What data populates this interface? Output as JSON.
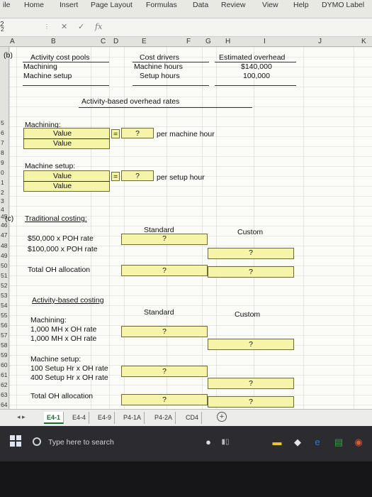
{
  "ribbon": {
    "tabs": [
      "ile",
      "Home",
      "Insert",
      "Page Layout",
      "Formulas",
      "Data",
      "Review",
      "View",
      "Help",
      "DYMO Label"
    ]
  },
  "formula_bar": {
    "name_box": "2",
    "cancel_symbol": "✕",
    "enter_symbol": "✓",
    "fx_label": "fx",
    "content": ""
  },
  "columns": [
    "A",
    "B",
    "C",
    "D",
    "E",
    "F",
    "G",
    "H",
    "I",
    "J",
    "K"
  ],
  "rows": [
    "2",
    "5",
    "6",
    "7",
    "8",
    "9",
    "0",
    "1",
    "2",
    "3",
    "4",
    "45",
    "46",
    "47",
    "48",
    "49",
    "50",
    "51",
    "52",
    "53",
    "54",
    "55",
    "56",
    "57",
    "58",
    "59",
    "60",
    "61",
    "62",
    "63",
    "64"
  ],
  "part_b": {
    "label": "(b)",
    "col1_header": "Activity cost pools",
    "col1_rows": [
      "Machining",
      "Machine setup"
    ],
    "col2_header": "Cost drivers",
    "col2_rows": [
      "Machine hours",
      "Setup hours"
    ],
    "col3_header": "Estimated overhead",
    "col3_rows": [
      "$140,000",
      "100,000"
    ],
    "rates_title": "Activity-based overhead rates",
    "machining_label": "Machining:",
    "machining_value1": "Value",
    "machining_value2": "Value",
    "equals": "=",
    "machining_answer": "?",
    "machining_unit": "per machine hour",
    "setup_label": "Machine setup:",
    "setup_value1": "Value",
    "setup_value2": "Value",
    "setup_answer": "?",
    "setup_unit": "per setup hour"
  },
  "part_c": {
    "label": "(c)",
    "traditional_title": "Traditional costing:",
    "standard_header": "Standard",
    "custom_header": "Custom",
    "rate_row1": "$50,000 x POH rate",
    "rate_row2": "$100,000 x POH rate",
    "total_oh": "Total OH allocation",
    "q": "?",
    "abc_title": "Activity-based costing",
    "abc_machining": "Machining:",
    "abc_mh_row1": "1,000 MH x OH rate",
    "abc_mh_row2": "1,000 MH x OH rate",
    "abc_setup": "Machine setup:",
    "abc_setup_row1": "100 Setup Hr x OH rate",
    "abc_setup_row2": "400 Setup Hr x OH rate",
    "abc_total": "Total OH allocation"
  },
  "sheet_tabs": [
    "E4-1",
    "E4-4",
    "E4-9",
    "P4-1A",
    "P4-2A",
    "CD4"
  ],
  "active_sheet": "E4-1",
  "add_sheet": "+",
  "taskbar": {
    "search_placeholder": "Type here to search"
  }
}
